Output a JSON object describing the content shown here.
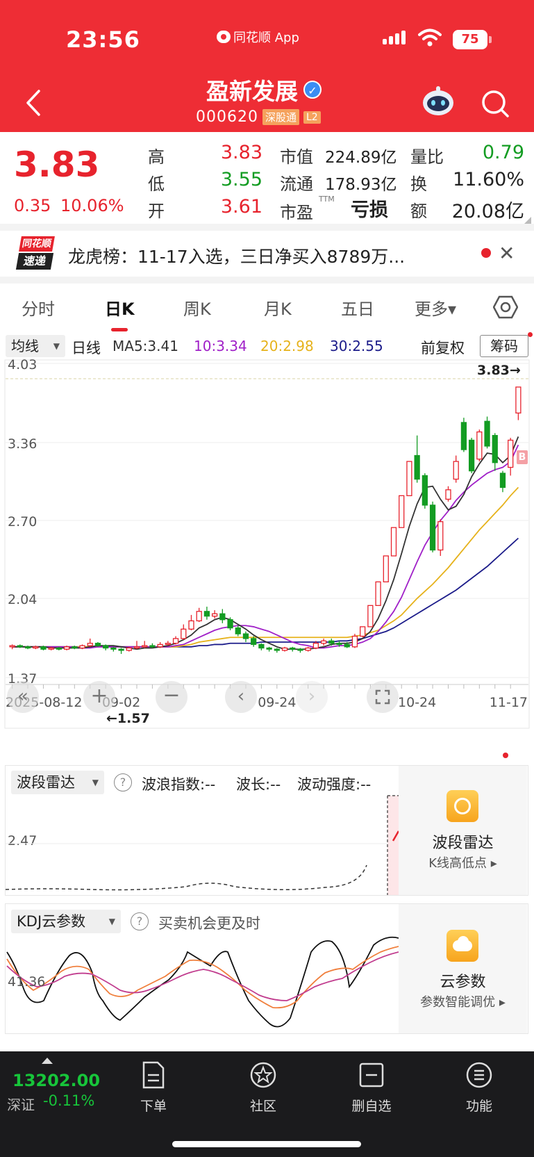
{
  "status": {
    "time": "23:56",
    "app": "同花顺 App",
    "battery": "75"
  },
  "header": {
    "name": "盈新发展",
    "code": "000620",
    "tag_market": "深股通",
    "tag_level": "L2"
  },
  "quote": {
    "price": "3.83",
    "change": "0.35",
    "pct": "10.06%",
    "high_label": "高",
    "high": "3.83",
    "low_label": "低",
    "low": "3.55",
    "open_label": "开",
    "open": "3.61",
    "mktcap_label": "市值",
    "mktcap": "224.89亿",
    "float_label": "流通",
    "float": "178.93亿",
    "pe_label": "市盈",
    "pe_sup": "TTM",
    "pe": "亏损",
    "vr_label": "量比",
    "vr": "0.79",
    "turn_label": "换",
    "turn": "11.60%",
    "amt_label": "额",
    "amt": "20.08亿"
  },
  "news": {
    "logo_top": "同花顺",
    "logo_bottom": "速递",
    "text": "龙虎榜：11-17入选，三日净买入8789万..."
  },
  "tabs": [
    "分时",
    "日K",
    "周K",
    "月K",
    "五日",
    "更多▾"
  ],
  "ma_row": {
    "select": "均线",
    "period": "日线",
    "ma5": "MA5:3.41",
    "ma10": "10:3.34",
    "ma20": "20:2.98",
    "ma30": "30:2.55",
    "fq": "前复权",
    "chouma": "筹码"
  },
  "chart_ticks": {
    "y": [
      "4.03",
      "3.36",
      "2.70",
      "2.04",
      "1.37"
    ],
    "x": [
      "2025-08-12",
      "09-02",
      "09-24",
      "10-24",
      "11-17"
    ],
    "last_price": "3.83→",
    "min_price": "←1.57",
    "marker": "B"
  },
  "chart_data": {
    "type": "candlestick",
    "y_range": [
      1.37,
      4.03
    ],
    "x_range": [
      "2025-08-12",
      "2025-11-17"
    ],
    "ma_colors": {
      "ma5": "#333333",
      "ma10": "#a020c8",
      "ma20": "#e6b21b",
      "ma30": "#1c1c8a"
    },
    "up_color": "#e7232d",
    "down_color": "#139c22",
    "candles": [
      [
        1.63,
        1.64,
        1.61,
        1.65
      ],
      [
        1.64,
        1.63,
        1.62,
        1.65
      ],
      [
        1.63,
        1.62,
        1.61,
        1.64
      ],
      [
        1.62,
        1.63,
        1.61,
        1.64
      ],
      [
        1.63,
        1.61,
        1.6,
        1.64
      ],
      [
        1.61,
        1.62,
        1.6,
        1.63
      ],
      [
        1.62,
        1.61,
        1.6,
        1.63
      ],
      [
        1.61,
        1.63,
        1.6,
        1.64
      ],
      [
        1.63,
        1.62,
        1.61,
        1.64
      ],
      [
        1.62,
        1.64,
        1.61,
        1.65
      ],
      [
        1.64,
        1.66,
        1.63,
        1.7
      ],
      [
        1.66,
        1.64,
        1.63,
        1.67
      ],
      [
        1.64,
        1.62,
        1.6,
        1.65
      ],
      [
        1.62,
        1.61,
        1.59,
        1.63
      ],
      [
        1.61,
        1.6,
        1.57,
        1.62
      ],
      [
        1.6,
        1.62,
        1.59,
        1.63
      ],
      [
        1.62,
        1.63,
        1.61,
        1.68
      ],
      [
        1.63,
        1.64,
        1.62,
        1.68
      ],
      [
        1.64,
        1.63,
        1.62,
        1.66
      ],
      [
        1.63,
        1.65,
        1.62,
        1.67
      ],
      [
        1.65,
        1.66,
        1.64,
        1.68
      ],
      [
        1.66,
        1.7,
        1.65,
        1.72
      ],
      [
        1.7,
        1.78,
        1.69,
        1.82
      ],
      [
        1.78,
        1.85,
        1.77,
        1.9
      ],
      [
        1.85,
        1.93,
        1.84,
        1.96
      ],
      [
        1.93,
        1.89,
        1.86,
        1.97
      ],
      [
        1.89,
        1.91,
        1.87,
        1.94
      ],
      [
        1.91,
        1.86,
        1.83,
        1.95
      ],
      [
        1.86,
        1.79,
        1.77,
        1.88
      ],
      [
        1.79,
        1.74,
        1.72,
        1.81
      ],
      [
        1.74,
        1.7,
        1.67,
        1.76
      ],
      [
        1.7,
        1.65,
        1.63,
        1.72
      ],
      [
        1.65,
        1.62,
        1.6,
        1.66
      ],
      [
        1.62,
        1.61,
        1.59,
        1.63
      ],
      [
        1.61,
        1.6,
        1.58,
        1.62
      ],
      [
        1.6,
        1.62,
        1.59,
        1.63
      ],
      [
        1.62,
        1.61,
        1.59,
        1.63
      ],
      [
        1.61,
        1.6,
        1.58,
        1.62
      ],
      [
        1.6,
        1.62,
        1.59,
        1.63
      ],
      [
        1.62,
        1.66,
        1.61,
        1.68
      ],
      [
        1.66,
        1.68,
        1.64,
        1.7
      ],
      [
        1.68,
        1.66,
        1.64,
        1.7
      ],
      [
        1.66,
        1.65,
        1.63,
        1.68
      ],
      [
        1.65,
        1.63,
        1.62,
        1.67
      ],
      [
        1.63,
        1.72,
        1.62,
        1.74
      ],
      [
        1.72,
        1.8,
        1.71,
        1.8
      ],
      [
        1.8,
        1.98,
        1.8,
        1.98
      ],
      [
        1.98,
        2.18,
        1.98,
        2.18
      ],
      [
        2.18,
        2.4,
        2.18,
        2.4
      ],
      [
        2.4,
        2.64,
        2.4,
        2.64
      ],
      [
        2.64,
        2.91,
        2.64,
        2.91
      ],
      [
        2.91,
        3.2,
        2.91,
        3.2
      ],
      [
        3.25,
        3.05,
        3.02,
        3.42
      ],
      [
        3.08,
        2.83,
        2.8,
        3.1
      ],
      [
        2.83,
        2.45,
        2.43,
        2.86
      ],
      [
        2.45,
        2.69,
        2.4,
        2.71
      ],
      [
        2.88,
        2.96,
        2.86,
        2.99
      ],
      [
        3.05,
        3.2,
        3.02,
        3.25
      ],
      [
        3.53,
        3.3,
        3.28,
        3.57
      ],
      [
        3.38,
        3.12,
        3.1,
        3.4
      ],
      [
        3.22,
        3.45,
        3.2,
        3.47
      ],
      [
        3.54,
        3.33,
        3.31,
        3.58
      ],
      [
        3.42,
        3.19,
        3.12,
        3.44
      ],
      [
        3.1,
        2.98,
        2.94,
        3.12
      ],
      [
        3.15,
        3.38,
        3.08,
        3.4
      ],
      [
        3.61,
        3.83,
        3.55,
        3.83
      ]
    ],
    "ma5": [
      1.63,
      1.63,
      1.63,
      1.63,
      1.63,
      1.62,
      1.62,
      1.62,
      1.62,
      1.62,
      1.63,
      1.64,
      1.64,
      1.64,
      1.63,
      1.62,
      1.61,
      1.62,
      1.62,
      1.63,
      1.64,
      1.66,
      1.69,
      1.73,
      1.79,
      1.82,
      1.86,
      1.88,
      1.86,
      1.82,
      1.78,
      1.73,
      1.69,
      1.66,
      1.63,
      1.61,
      1.61,
      1.61,
      1.61,
      1.62,
      1.63,
      1.65,
      1.66,
      1.66,
      1.67,
      1.7,
      1.76,
      1.87,
      2.02,
      2.2,
      2.42,
      2.65,
      2.84,
      2.98,
      2.99,
      2.88,
      2.79,
      2.82,
      2.92,
      3.07,
      3.18,
      3.27,
      3.26,
      3.19,
      3.25,
      3.41
    ],
    "ma10": [
      1.63,
      1.63,
      1.63,
      1.63,
      1.63,
      1.63,
      1.63,
      1.63,
      1.63,
      1.62,
      1.62,
      1.63,
      1.63,
      1.63,
      1.63,
      1.63,
      1.63,
      1.63,
      1.63,
      1.63,
      1.63,
      1.64,
      1.65,
      1.68,
      1.71,
      1.74,
      1.77,
      1.79,
      1.8,
      1.81,
      1.81,
      1.8,
      1.78,
      1.76,
      1.73,
      1.7,
      1.67,
      1.65,
      1.64,
      1.62,
      1.62,
      1.63,
      1.64,
      1.64,
      1.65,
      1.67,
      1.7,
      1.76,
      1.84,
      1.93,
      2.05,
      2.2,
      2.35,
      2.49,
      2.6,
      2.7,
      2.78,
      2.87,
      2.94,
      3.0,
      3.05,
      3.1,
      3.13,
      3.15,
      3.2,
      3.34
    ],
    "ma20": [
      1.63,
      1.63,
      1.63,
      1.63,
      1.63,
      1.63,
      1.63,
      1.63,
      1.63,
      1.63,
      1.63,
      1.63,
      1.63,
      1.63,
      1.63,
      1.63,
      1.63,
      1.63,
      1.63,
      1.63,
      1.63,
      1.63,
      1.64,
      1.65,
      1.67,
      1.68,
      1.69,
      1.7,
      1.71,
      1.71,
      1.71,
      1.71,
      1.71,
      1.71,
      1.71,
      1.71,
      1.71,
      1.71,
      1.71,
      1.71,
      1.71,
      1.71,
      1.71,
      1.71,
      1.72,
      1.73,
      1.75,
      1.77,
      1.81,
      1.85,
      1.9,
      1.97,
      2.04,
      2.1,
      2.16,
      2.23,
      2.3,
      2.38,
      2.46,
      2.54,
      2.62,
      2.69,
      2.76,
      2.83,
      2.91,
      2.98
    ],
    "ma30": [
      1.63,
      1.63,
      1.63,
      1.63,
      1.63,
      1.63,
      1.63,
      1.63,
      1.63,
      1.63,
      1.63,
      1.63,
      1.63,
      1.63,
      1.63,
      1.63,
      1.63,
      1.63,
      1.63,
      1.63,
      1.63,
      1.63,
      1.63,
      1.63,
      1.64,
      1.64,
      1.65,
      1.65,
      1.66,
      1.66,
      1.66,
      1.66,
      1.67,
      1.67,
      1.67,
      1.67,
      1.67,
      1.67,
      1.67,
      1.67,
      1.67,
      1.67,
      1.68,
      1.68,
      1.69,
      1.7,
      1.72,
      1.74,
      1.76,
      1.79,
      1.83,
      1.87,
      1.91,
      1.95,
      1.99,
      2.03,
      2.07,
      2.11,
      2.16,
      2.21,
      2.26,
      2.31,
      2.37,
      2.43,
      2.49,
      2.55
    ]
  },
  "wave_panel": {
    "select": "波段雷达",
    "help": "?",
    "index": "波浪指数:--",
    "length": "波长:--",
    "strength": "波动强度:--",
    "y_tick": "2.47",
    "side_title": "波段雷达",
    "side_sub": "K线高低点 ▸"
  },
  "kdj_panel": {
    "select": "KDJ云参数",
    "help": "?",
    "desc": "买卖机会更及时",
    "y_tick": "41.36",
    "side_title": "云参数",
    "side_sub": "参数智能调优 ▸"
  },
  "bottom": {
    "index_value": "13202.00",
    "index_name": "深证",
    "index_pct": "-0.11%",
    "nav": [
      "下单",
      "社区",
      "删自选",
      "功能"
    ]
  }
}
